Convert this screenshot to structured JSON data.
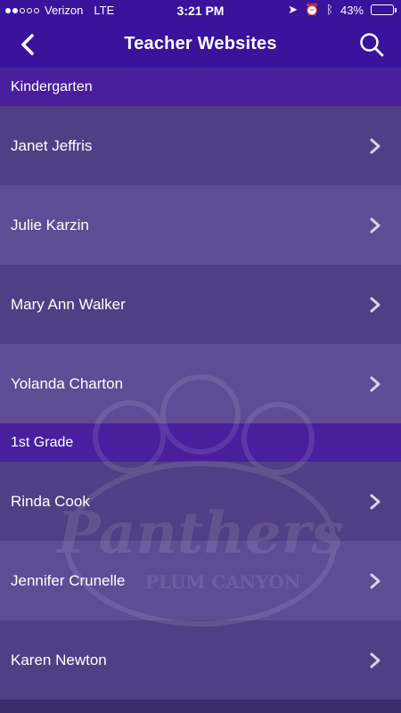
{
  "status_bar": {
    "carrier": "Verizon",
    "network": "LTE",
    "time": "3:21 PM",
    "battery": "43%",
    "battery_level": 0.43,
    "signal_bars_filled": 2,
    "signal_bars_total": 5
  },
  "nav": {
    "title": "Teacher Websites",
    "back_icon": "chevron-left-icon",
    "search_icon": "search-icon"
  },
  "sections": [
    {
      "header": "Kindergarten",
      "items": [
        {
          "name": "Janet Jeffris"
        },
        {
          "name": "Julie Karzin"
        },
        {
          "name": "Mary Ann Walker"
        },
        {
          "name": "Yolanda Charton"
        }
      ]
    },
    {
      "header": "1st Grade",
      "items": [
        {
          "name": "Rinda Cook"
        },
        {
          "name": "Jennifer Crunelle"
        },
        {
          "name": "Karen Newton"
        }
      ]
    }
  ],
  "watermark": {
    "word": "Panthers",
    "subword": "PLUM CANYON"
  },
  "colors": {
    "nav_bg": "#3a139c",
    "section_bg": "#4a1f9e",
    "row_dark": "#523e84",
    "row_light": "#5f4c94"
  }
}
